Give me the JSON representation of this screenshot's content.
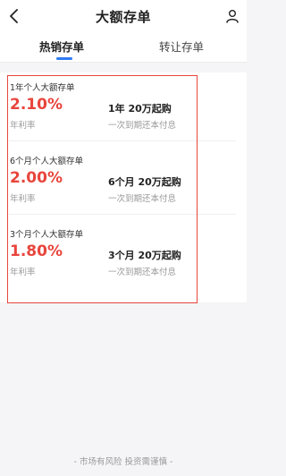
{
  "header": {
    "title": "大额存单",
    "back_icon": "chevron-left-icon",
    "user_icon": "person-icon"
  },
  "tabs": [
    {
      "label": "热销存单",
      "active": true
    },
    {
      "label": "转让存单",
      "active": false
    }
  ],
  "products": [
    {
      "name": "1年个人大额存单",
      "rate": "2.10%",
      "rate_label": "年利率",
      "terms": "1年 20万起购",
      "payment": "一次到期还本付息"
    },
    {
      "name": "6个月个人大额存单",
      "rate": "2.00%",
      "rate_label": "年利率",
      "terms": "6个月 20万起购",
      "payment": "一次到期还本付息"
    },
    {
      "name": "3个月个人大额存单",
      "rate": "1.80%",
      "rate_label": "年利率",
      "terms": "3个月 20万起购",
      "payment": "一次到期还本付息"
    }
  ],
  "footer": {
    "note": "- 市场有风险 投资需谨慎 -"
  },
  "colors": {
    "accent": "#2f7bf5",
    "rate": "#e8453c",
    "highlight": "#e8453c",
    "background": "#f5f5f7"
  }
}
